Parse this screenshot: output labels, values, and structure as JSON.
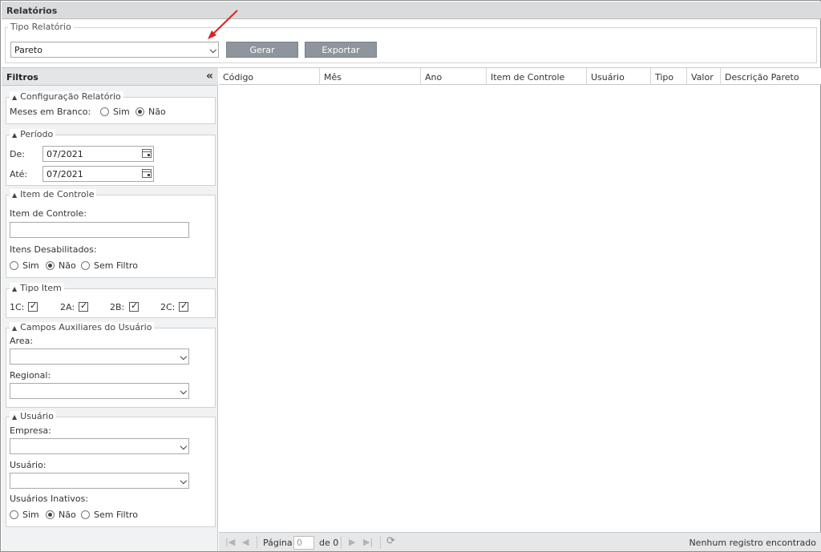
{
  "window": {
    "title": "Relatórios"
  },
  "report_type": {
    "legend": "Tipo Relatório",
    "selected": "Pareto",
    "generate_label": "Gerar",
    "export_label": "Exportar"
  },
  "filters": {
    "title": "Filtros",
    "collapse_icon": "«",
    "config": {
      "legend": "Configuração Relatório",
      "blank_months_label": "Meses em Branco:",
      "options": [
        "Sim",
        "Não"
      ],
      "selected": "Não"
    },
    "period": {
      "legend": "Período",
      "from_label": "De:",
      "from_value": "07/2021",
      "to_label": "Até:",
      "to_value": "07/2021"
    },
    "control_item": {
      "legend": "Item de Controle",
      "field_label": "Item de Controle:",
      "field_value": "",
      "disabled_label": "Itens Desabilitados:",
      "options": [
        "Sim",
        "Não",
        "Sem Filtro"
      ],
      "selected": "Não"
    },
    "item_type": {
      "legend": "Tipo Item",
      "items": [
        {
          "label": "1C:",
          "checked": true
        },
        {
          "label": "2A:",
          "checked": true
        },
        {
          "label": "2B:",
          "checked": true
        },
        {
          "label": "2C:",
          "checked": true
        }
      ]
    },
    "aux_fields": {
      "legend": "Campos Auxiliares do Usuário",
      "area_label": "Area:",
      "area_value": "",
      "regional_label": "Regional:",
      "regional_value": ""
    },
    "user": {
      "legend": "Usuário",
      "company_label": "Empresa:",
      "company_value": "",
      "user_label": "Usuário:",
      "user_value": "",
      "inactive_label": "Usuários Inativos:",
      "options": [
        "Sim",
        "Não",
        "Sem Filtro"
      ],
      "selected": "Não"
    }
  },
  "grid": {
    "columns": [
      "Código",
      "Mês",
      "Ano",
      "Item de Controle",
      "Usuário",
      "Tipo",
      "Valor",
      "Descrição Pareto"
    ],
    "rows": []
  },
  "pager": {
    "page_label": "Página",
    "page_value": "0",
    "of_label": "de 0",
    "status": "Nenhum registro encontrado"
  }
}
